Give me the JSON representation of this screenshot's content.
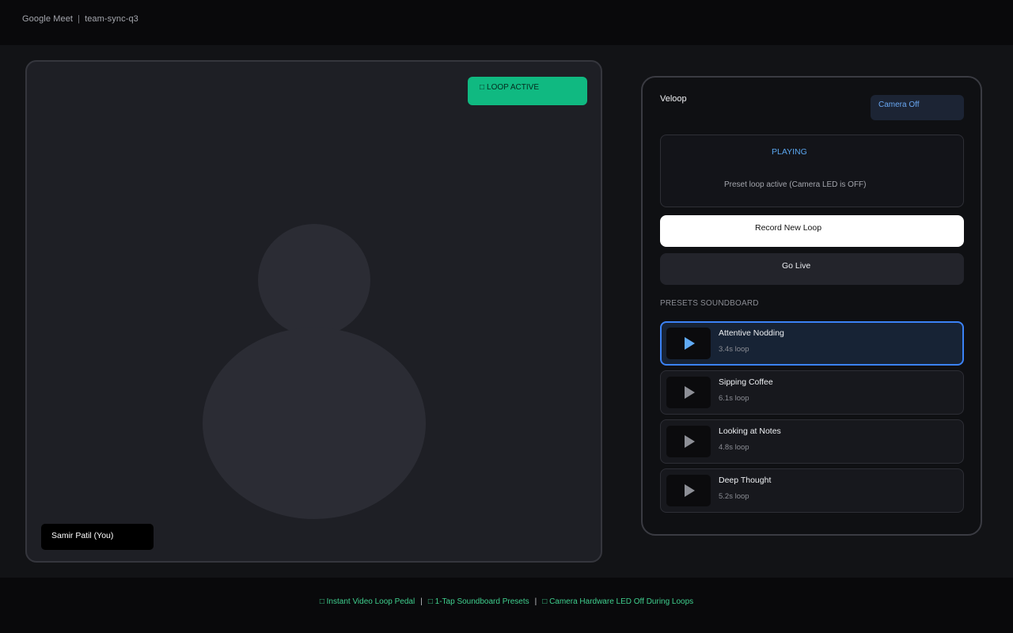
{
  "header": {
    "app_name": "Google Meet",
    "separator": "|",
    "meeting_code": "team-sync-q3"
  },
  "stage": {
    "loop_badge": {
      "icon": "□",
      "label": "LOOP ACTIVE"
    },
    "participant_name": "Samir Patil (You)"
  },
  "panel": {
    "brand": "Veloop",
    "camera_button": "Camera Off",
    "status": {
      "state": "PLAYING",
      "description": "Preset loop active (Camera LED is OFF)"
    },
    "record_button": "Record New Loop",
    "live_button": "Go Live",
    "presets_label": "PRESETS SOUNDBOARD",
    "presets": [
      {
        "name": "Attentive Nodding",
        "length": "3.4s loop",
        "active": true
      },
      {
        "name": "Sipping Coffee",
        "length": "6.1s loop",
        "active": false
      },
      {
        "name": "Looking at Notes",
        "length": "4.8s loop",
        "active": false
      },
      {
        "name": "Deep Thought",
        "length": "5.2s loop",
        "active": false
      }
    ]
  },
  "footer": {
    "features": [
      {
        "icon": "□",
        "label": "Instant Video Loop Pedal"
      },
      {
        "icon": "□",
        "label": "1-Tap Soundboard Presets"
      },
      {
        "icon": "□",
        "label": "Camera Hardware LED Off During Loops"
      }
    ],
    "separator": "|"
  },
  "colors": {
    "accent_green": "#10b981",
    "accent_blue": "#3b82f6",
    "status_blue": "#5aa6ef",
    "footer_green": "#3fcf8e"
  }
}
